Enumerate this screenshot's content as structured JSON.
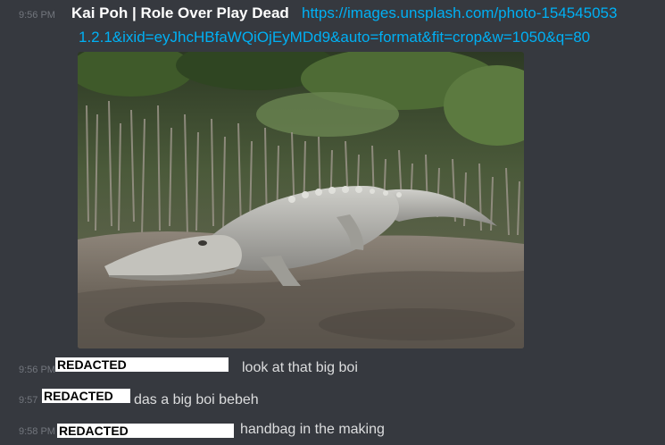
{
  "messages": [
    {
      "timestamp": "9:56 PM",
      "author": "Kai Poh | Role Over Play Dead",
      "link_line1": "https://images.unsplash.com/photo-154545053",
      "link_line2": "1.2.1&ixid=eyJhcHBfaWQiOjEyMDd9&auto=format&fit=crop&w=1050&q=80"
    },
    {
      "timestamp": "9:56 PM",
      "redacted_label": "REDACTED",
      "text": "look at that big boi"
    },
    {
      "timestamp": "9:57",
      "redacted_label": "REDACTED",
      "text": "das a big boi bebeh"
    },
    {
      "timestamp": "9:58 PM",
      "redacted_label": "REDACTED",
      "text": "handbag in the making"
    }
  ],
  "embed": {
    "image_subject": "crocodile-on-mudflat-photo"
  },
  "colors": {
    "background": "#36393f",
    "link": "#00b0f4",
    "timestamp": "#72767d",
    "text": "#dcddde"
  }
}
